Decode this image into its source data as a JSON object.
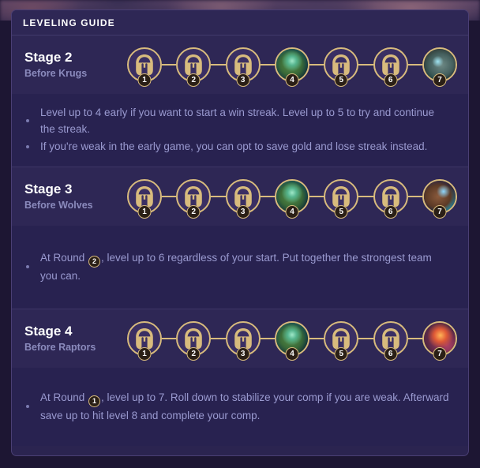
{
  "card": {
    "header_title": "LEVELING GUIDE"
  },
  "colors": {
    "card_background": "#2b2450",
    "row_background": "#2e2755",
    "tips_background": "#282250",
    "gold": "#d8bb7d",
    "title_text": "#ffffff",
    "subtitle_text": "#8b8bbd",
    "tip_text": "#9a9ad0",
    "page_background": "#1d1633"
  },
  "stages": [
    {
      "title": "Stage 2",
      "subtitle": "Before Krugs",
      "rounds": [
        {
          "number": "1",
          "icon": "helmet-icon",
          "art": "none"
        },
        {
          "number": "2",
          "icon": "helmet-icon",
          "art": "none"
        },
        {
          "number": "3",
          "icon": "helmet-icon",
          "art": "none"
        },
        {
          "number": "4",
          "icon": "krug-monster-icon",
          "art": "krug"
        },
        {
          "number": "5",
          "icon": "helmet-icon",
          "art": "none"
        },
        {
          "number": "6",
          "icon": "helmet-icon",
          "art": "none"
        },
        {
          "number": "7",
          "icon": "krug-boss-icon",
          "art": "dark"
        }
      ],
      "tips": [
        {
          "prefix": "Level up to 4 early if you want to start a win streak. Level up to 5 to try and continue the streak.",
          "badge": "",
          "suffix": ""
        },
        {
          "prefix": "If you're weak in the early game, you can opt to save gold and lose streak instead.",
          "badge": "",
          "suffix": ""
        }
      ]
    },
    {
      "title": "Stage 3",
      "subtitle": "Before Wolves",
      "rounds": [
        {
          "number": "1",
          "icon": "helmet-icon",
          "art": "none"
        },
        {
          "number": "2",
          "icon": "helmet-icon",
          "art": "none"
        },
        {
          "number": "3",
          "icon": "helmet-icon",
          "art": "none"
        },
        {
          "number": "4",
          "icon": "krug-monster-icon",
          "art": "krug"
        },
        {
          "number": "5",
          "icon": "helmet-icon",
          "art": "none"
        },
        {
          "number": "6",
          "icon": "helmet-icon",
          "art": "none"
        },
        {
          "number": "7",
          "icon": "wolves-icon",
          "art": "wolves"
        }
      ],
      "tips": [
        {
          "prefix": "At Round ",
          "badge": "2",
          "suffix": ", level up to 6 regardless of your start. Put together the strongest team you can."
        }
      ]
    },
    {
      "title": "Stage 4",
      "subtitle": "Before Raptors",
      "rounds": [
        {
          "number": "1",
          "icon": "helmet-icon",
          "art": "none"
        },
        {
          "number": "2",
          "icon": "helmet-icon",
          "art": "none"
        },
        {
          "number": "3",
          "icon": "helmet-icon",
          "art": "none"
        },
        {
          "number": "4",
          "icon": "krug-monster-icon",
          "art": "krug"
        },
        {
          "number": "5",
          "icon": "helmet-icon",
          "art": "none"
        },
        {
          "number": "6",
          "icon": "helmet-icon",
          "art": "none"
        },
        {
          "number": "7",
          "icon": "raptors-icon",
          "art": "raptors"
        }
      ],
      "tips": [
        {
          "prefix": "At Round ",
          "badge": "1",
          "suffix": ", level up to 7. Roll down to stabilize your comp if you are weak. Afterward save up to hit level 8 and complete your comp."
        }
      ]
    }
  ]
}
